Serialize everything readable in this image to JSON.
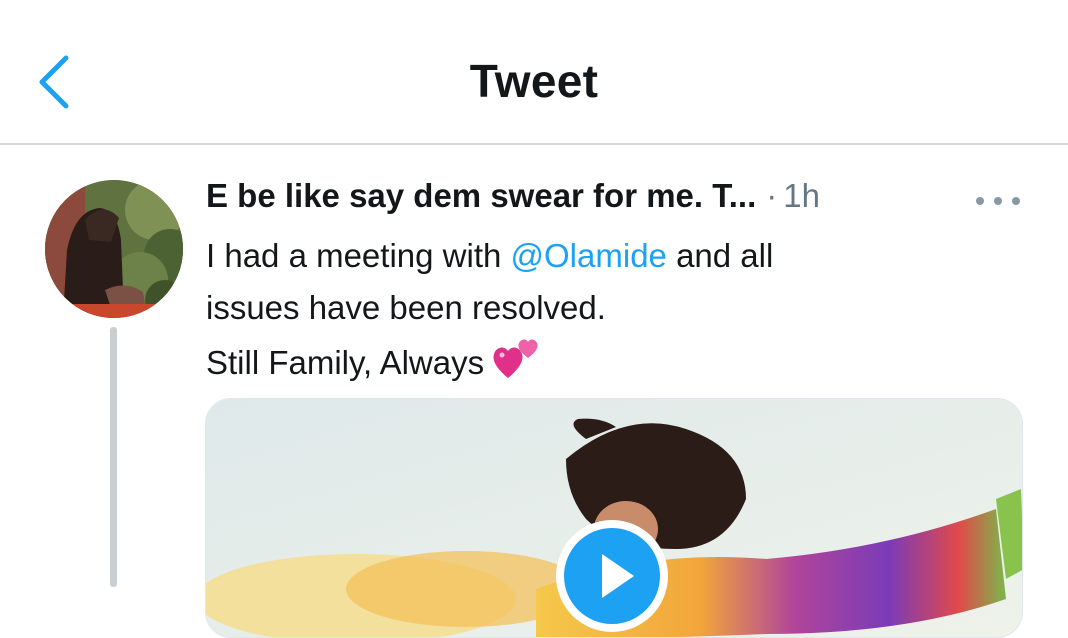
{
  "header": {
    "title": "Tweet",
    "back_icon": "chevron-left-icon",
    "accent_color": "#1da1f2"
  },
  "tweet": {
    "display_name": "E be like say dem swear for me. T...",
    "separator": "·",
    "timestamp": "1h",
    "more_icon": "ellipsis-icon",
    "text": {
      "line1_before": "I had a meeting with ",
      "mention": "@Olamide",
      "line1_after": " and all",
      "line2": "issues have been resolved.",
      "line3": "Still Family, Always",
      "emoji": "two-hearts-emoji"
    },
    "media": {
      "type": "video",
      "play_icon": "play-icon"
    }
  }
}
